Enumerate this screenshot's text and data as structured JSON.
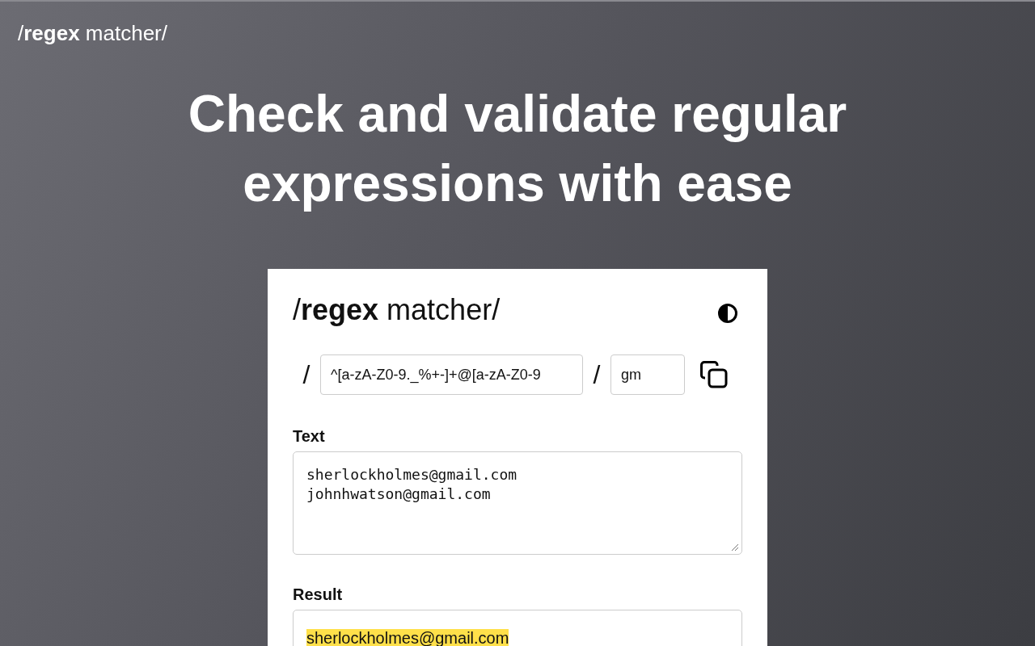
{
  "header": {
    "logo": "/**regex** matcher/"
  },
  "hero": {
    "headline": "Check and validate regular expressions with ease"
  },
  "card": {
    "logo": "/**regex** matcher/",
    "pattern": {
      "open_delimiter": "/",
      "value": "^[a-zA-Z0-9._%+-]+@[a-zA-Z0-9",
      "close_delimiter": "/",
      "flags": "gm"
    },
    "text_section": {
      "label": "Text",
      "lines": [
        "sherlockholmes@gmail.com",
        "johnhwatson@gmail.com"
      ]
    },
    "result_section": {
      "label": "Result",
      "matches": [
        {
          "text": "sherlockholmes@gmail.com",
          "highlighted": true
        }
      ]
    }
  }
}
